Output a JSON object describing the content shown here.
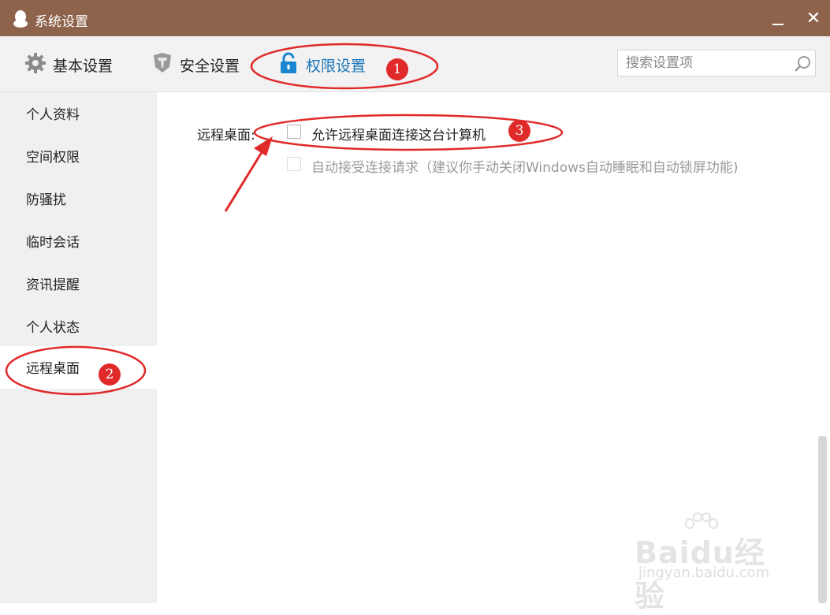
{
  "window": {
    "title": "系统设置",
    "minimize_icon": "minimize-icon",
    "close_label": "✕"
  },
  "toolbar": {
    "tabs": [
      {
        "label": "基本设置",
        "icon": "gear-icon"
      },
      {
        "label": "安全设置",
        "icon": "shield-icon"
      },
      {
        "label": "权限设置",
        "icon": "lock-icon",
        "active": true
      }
    ],
    "search_placeholder": "搜索设置项"
  },
  "sidebar": {
    "items": [
      {
        "label": "个人资料"
      },
      {
        "label": "空间权限"
      },
      {
        "label": "防骚扰"
      },
      {
        "label": "临时会话"
      },
      {
        "label": "资讯提醒"
      },
      {
        "label": "个人状态"
      },
      {
        "label": "远程桌面",
        "active": true
      }
    ]
  },
  "content": {
    "remote_desktop_label": "远程桌面:",
    "allow_remote": {
      "label": "允许远程桌面连接这台计算机",
      "checked": false
    },
    "auto_accept": {
      "label": "自动接受连接请求（建议你手动关闭Windows自动睡眠和自动锁屏功能)",
      "checked": false,
      "disabled": true
    }
  },
  "annotations": {
    "badge1": "1",
    "badge2": "2",
    "badge3": "3"
  },
  "watermark": {
    "brand": "Baidu经验",
    "url": "jingyan.baidu.com"
  },
  "colors": {
    "titlebar": "#8d634c",
    "accent": "#1a74b8",
    "annotation_red": "#e02a2a"
  }
}
